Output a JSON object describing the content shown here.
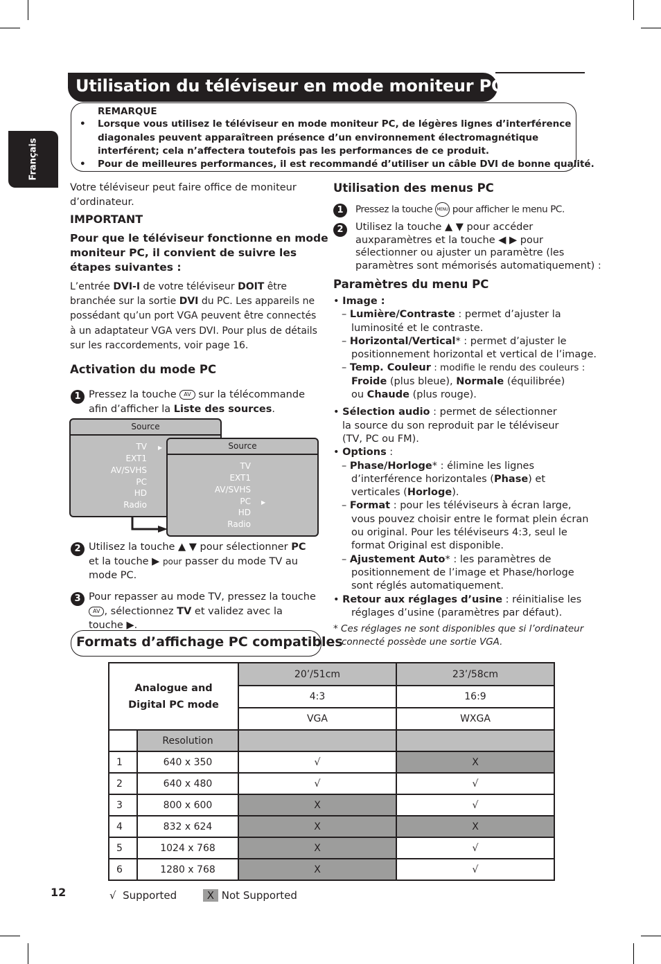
{
  "page": {
    "language_tab": "Français",
    "title": "Utilisation du téléviseur en mode moniteur PC",
    "page_number": "12"
  },
  "note": {
    "title": "REMARQUE",
    "bullets": [
      [
        "Lorsque vous utilisez le téléviseur en mode moniteur PC, de légères lignes d’interférence",
        "diagonales peuvent apparaîtreen présence d’un environnement électromagnétique",
        "interférent; cela n’affectera toutefois pas les performances de ce produit."
      ],
      [
        "Pour de meilleures performances, il est recommandé d’utiliser un câble DVI de bonne qualité."
      ]
    ]
  },
  "left": {
    "intro": [
      "Votre téléviseur peut faire office de moniteur",
      "d’ordinateur."
    ],
    "important_label": "IMPORTANT",
    "important_text": [
      "Pour que le téléviseur fonctionne en mode",
      "moniteur PC, il convient de suivre les",
      "étapes suivantes :"
    ],
    "dvi_para": {
      "l1a": "L’entrée ",
      "l1b": "DVI-I",
      "l1c": " de votre téléviseur ",
      "l1d": "DOIT",
      "l1e": " être",
      "l2a": "branchée sur la sortie ",
      "l2b": "DVI",
      "l2c": " du PC. Les appareils ne",
      "l3": "possédant qu’un port VGA peuvent être connectés",
      "l4": "à un adaptateur VGA vers DVI. Pour plus de détails",
      "l5": "sur les raccordements, voir page 16."
    },
    "activation_heading": "Activation du mode PC",
    "step1": {
      "n": "1",
      "a": "Pressez la touche ",
      "key": "AV",
      "b": " sur la télécommande",
      "c": "afin d’afficher la ",
      "d": "Liste des sources",
      "e": "."
    },
    "menu1": {
      "title": "Source",
      "items": [
        "TV",
        "EXT1",
        "AV/SVHS",
        "PC",
        "HD",
        "Radio"
      ],
      "selected": "TV"
    },
    "menu2": {
      "title": "Source",
      "items": [
        "TV",
        "EXT1",
        "AV/SVHS",
        "PC",
        "HD",
        "Radio"
      ],
      "selected": "PC"
    },
    "step2": {
      "n": "2",
      "a": "Utilisez la touche ▲ ▼ pour sélectionner ",
      "b": "PC",
      "c": "et la touche ▶ ",
      "d": "pour",
      "e": " passer du mode TV au",
      "f": "mode PC."
    },
    "step3": {
      "n": "3",
      "a": "Pour repasser au mode TV, pressez la touche",
      "key": "AV",
      "b": ", sélectionnez ",
      "c": "TV",
      "d": " et validez avec la",
      "e": "touche ▶."
    },
    "formats_heading": "Formats d’affichage PC compatibles"
  },
  "right": {
    "menus_heading": "Utilisation des menus PC",
    "step1": {
      "n": "1",
      "a": "Pressez la touche ",
      "key": "MENU",
      "b": " pour afficher le menu PC."
    },
    "step2": {
      "n": "2",
      "lines": [
        "Utilisez la touche ▲ ▼ pour accéder",
        "auxparamètres et la touche ◀ ▶ pour",
        "sélectionner ou ajuster un paramètre (les",
        "paramètres sont mémorisés automatiquement) :"
      ]
    },
    "params_heading": "Paramètres du menu PC",
    "image_label": "Image :",
    "lumiere": {
      "b": "Lumière/Contraste",
      "t1": " : permet d’ajuster la",
      "t2": "luminosité et le contraste."
    },
    "horiz": {
      "b": "Horizontal/Vertical",
      "star": "*",
      "t1": " : permet d’ajuster le",
      "t2": "positionnement horizontal et vertical de l’image."
    },
    "temp": {
      "b": "Temp. Couleur",
      "t1": " : modifie le rendu des couleurs :",
      "froide": "Froide",
      "froide_t": " (plus bleue), ",
      "normale": "Normale",
      "normale_t": " (équilibrée)",
      "ou": "ou ",
      "chaude": "Chaude",
      "chaude_t": " (plus rouge)."
    },
    "audio": {
      "b": "Sélection audio",
      "t1": " : permet de sélectionner",
      "t2": "la source du son reproduit par le téléviseur",
      "t3": "(TV, PC ou FM)."
    },
    "options_label": "Options",
    "options_colon": " :",
    "phase": {
      "b": "Phase/Horloge",
      "star": "*",
      "t1": " : élimine les lignes",
      "t2a": "d’interférence horizontales (",
      "t2b": "Phase",
      "t2c": ") et",
      "t3a": "verticales (",
      "t3b": "Horloge",
      "t3c": ")."
    },
    "format": {
      "b": "Format",
      "t1": " : pour les téléviseurs à écran large,",
      "t2": "vous pouvez choisir entre le format plein écran",
      "t3": "ou original. Pour les téléviseurs 4:3, seul le",
      "t4": "format Original est disponible."
    },
    "ajust": {
      "b": "Ajustement Auto",
      "star": "*",
      "t1": " : les paramètres de",
      "t2": "positionnement de l’image et Phase/horloge",
      "t3": "sont réglés automatiquement."
    },
    "retour": {
      "b": "Retour aux réglages d’usine",
      "t1": " : réinitialise les",
      "t2": "réglages d’usine (paramètres par défaut)."
    },
    "footnote": {
      "star": "*",
      "t1": "Ces réglages ne sont disponibles que si l’ordinateur",
      "t2": "connecté possède une sortie VGA."
    }
  },
  "table": {
    "corner_label": [
      "Analogue and",
      "Digital PC mode"
    ],
    "columns": [
      {
        "size": "20’/51cm",
        "aspect": "4:3",
        "standard": "VGA"
      },
      {
        "size": "23’/58cm",
        "aspect": "16:9",
        "standard": "WXGA"
      }
    ],
    "resolution_header": "Resolution",
    "rows": [
      {
        "index": "1",
        "resolution": "640 x 350",
        "vga": "√",
        "wxga": "X"
      },
      {
        "index": "2",
        "resolution": "640 x 480",
        "vga": "√",
        "wxga": "√"
      },
      {
        "index": "3",
        "resolution": "800 x 600",
        "vga": "X",
        "wxga": "√"
      },
      {
        "index": "4",
        "resolution": "832 x 624",
        "vga": "X",
        "wxga": "X"
      },
      {
        "index": "5",
        "resolution": "1024 x 768",
        "vga": "X",
        "wxga": "√"
      },
      {
        "index": "6",
        "resolution": "1280 x 768",
        "vga": "X",
        "wxga": "√"
      }
    ]
  },
  "legend": {
    "supported_symbol": "√",
    "supported": "Supported",
    "not_supported_symbol": "X",
    "not_supported": "Not Supported"
  },
  "colors": {
    "ink": "#231f20",
    "light_gray": "#bebebe",
    "dark_gray": "#9d9d9c"
  }
}
